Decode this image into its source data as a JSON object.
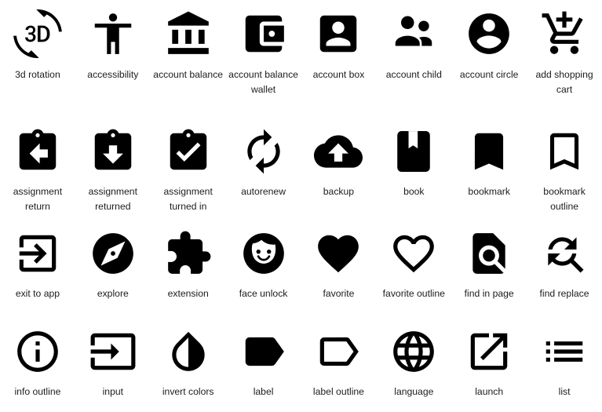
{
  "page": {
    "title": "Material Icon Gallery",
    "background_color": "#ffffff",
    "icon_color": "#000000",
    "label_color": "#1c1c1c",
    "columns": 8,
    "rows": 4,
    "total_icons": 32
  },
  "icons": [
    {
      "name": "3d rotation",
      "icon": "3d-rotation-icon"
    },
    {
      "name": "accessibility",
      "icon": "accessibility-icon"
    },
    {
      "name": "account balance",
      "icon": "account-balance-icon"
    },
    {
      "name": "account balance wallet",
      "icon": "account-balance-wallet-icon"
    },
    {
      "name": "account box",
      "icon": "account-box-icon"
    },
    {
      "name": "account child",
      "icon": "account-child-icon"
    },
    {
      "name": "account circle",
      "icon": "account-circle-icon"
    },
    {
      "name": "add shopping cart",
      "icon": "add-shopping-cart-icon"
    },
    {
      "name": "assignment return",
      "icon": "assignment-return-icon"
    },
    {
      "name": "assignment returned",
      "icon": "assignment-returned-icon"
    },
    {
      "name": "assignment turned in",
      "icon": "assignment-turned-in-icon"
    },
    {
      "name": "autorenew",
      "icon": "autorenew-icon"
    },
    {
      "name": "backup",
      "icon": "backup-icon"
    },
    {
      "name": "book",
      "icon": "book-icon"
    },
    {
      "name": "bookmark",
      "icon": "bookmark-icon"
    },
    {
      "name": "bookmark outline",
      "icon": "bookmark-outline-icon"
    },
    {
      "name": "exit to app",
      "icon": "exit-to-app-icon"
    },
    {
      "name": "explore",
      "icon": "explore-icon"
    },
    {
      "name": "extension",
      "icon": "extension-icon"
    },
    {
      "name": "face unlock",
      "icon": "face-unlock-icon"
    },
    {
      "name": "favorite",
      "icon": "favorite-icon"
    },
    {
      "name": "favorite outline",
      "icon": "favorite-outline-icon"
    },
    {
      "name": "find in page",
      "icon": "find-in-page-icon"
    },
    {
      "name": "find replace",
      "icon": "find-replace-icon"
    },
    {
      "name": "info outline",
      "icon": "info-outline-icon"
    },
    {
      "name": "input",
      "icon": "input-icon"
    },
    {
      "name": "invert colors",
      "icon": "invert-colors-icon"
    },
    {
      "name": "label",
      "icon": "label-icon"
    },
    {
      "name": "label outline",
      "icon": "label-outline-icon"
    },
    {
      "name": "language",
      "icon": "language-icon"
    },
    {
      "name": "launch",
      "icon": "launch-icon"
    },
    {
      "name": "list",
      "icon": "list-icon"
    }
  ]
}
